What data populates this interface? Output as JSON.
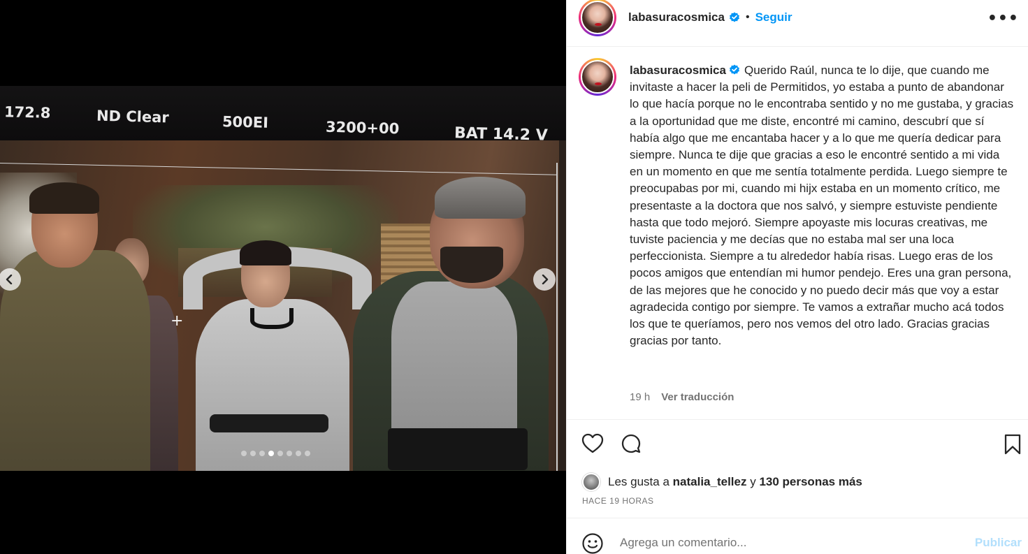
{
  "media": {
    "monitor_readouts": [
      "172.8",
      "ND Clear",
      "500EI",
      "3200+00",
      "BAT 14.2 V"
    ],
    "prev_icon": "chevron-left-icon",
    "next_icon": "chevron-right-icon",
    "crosshair": "+",
    "carousel": {
      "count": 8,
      "active_index": 3
    }
  },
  "header": {
    "username": "labasuracosmica",
    "separator": "•",
    "follow_label": "Seguir",
    "more_label": "•••"
  },
  "caption": {
    "username": "labasuracosmica",
    "text": "Querido Raúl, nunca te lo dije, que cuando me invitaste a hacer la peli de Permitidos, yo estaba a punto de abandonar lo que hacía porque no le encontraba sentido y no me gustaba, y gracias a la oportunidad que me diste, encontré mi camino, descubrí que sí había algo que me encantaba hacer y a lo que me quería dedicar para siempre. Nunca te dije que gracias a eso le encontré sentido a mi vida en un momento en que me sentía totalmente perdida. Luego siempre te preocupabas por mi, cuando mi hijx estaba en un momento crítico, me presentaste a la doctora que nos salvó, y siempre estuviste pendiente hasta que todo mejoró. Siempre apoyaste mis locuras creativas, me tuviste paciencia y me decías que no estaba mal ser una loca perfeccionista. Siempre a tu alrededor había risas. Luego eras de los pocos amigos que entendían mi humor pendejo. Eres una gran persona, de las mejores que he conocido y no puedo decir más que voy a estar agradecida contigo por siempre. Te vamos a extrañar mucho acá todos los que te queríamos, pero nos vemos del otro lado. Gracias gracias gracias por tanto.",
    "time": "19 h",
    "translate_label": "Ver traducción"
  },
  "actions": {
    "like_icon": "heart-icon",
    "comment_icon": "comment-icon",
    "save_icon": "bookmark-icon"
  },
  "likes": {
    "prefix": "Les gusta a",
    "user": "natalia_tellez",
    "joiner": "y",
    "others": "130 personas más",
    "time_ago": "HACE 19 HORAS"
  },
  "comment": {
    "emoji_icon": "smiley-icon",
    "placeholder": "Agrega un comentario...",
    "publish_label": "Publicar"
  },
  "colors": {
    "accent": "#0095f6",
    "publish_disabled": "#b2dffc",
    "text_primary": "#262626",
    "text_secondary": "#737373"
  }
}
